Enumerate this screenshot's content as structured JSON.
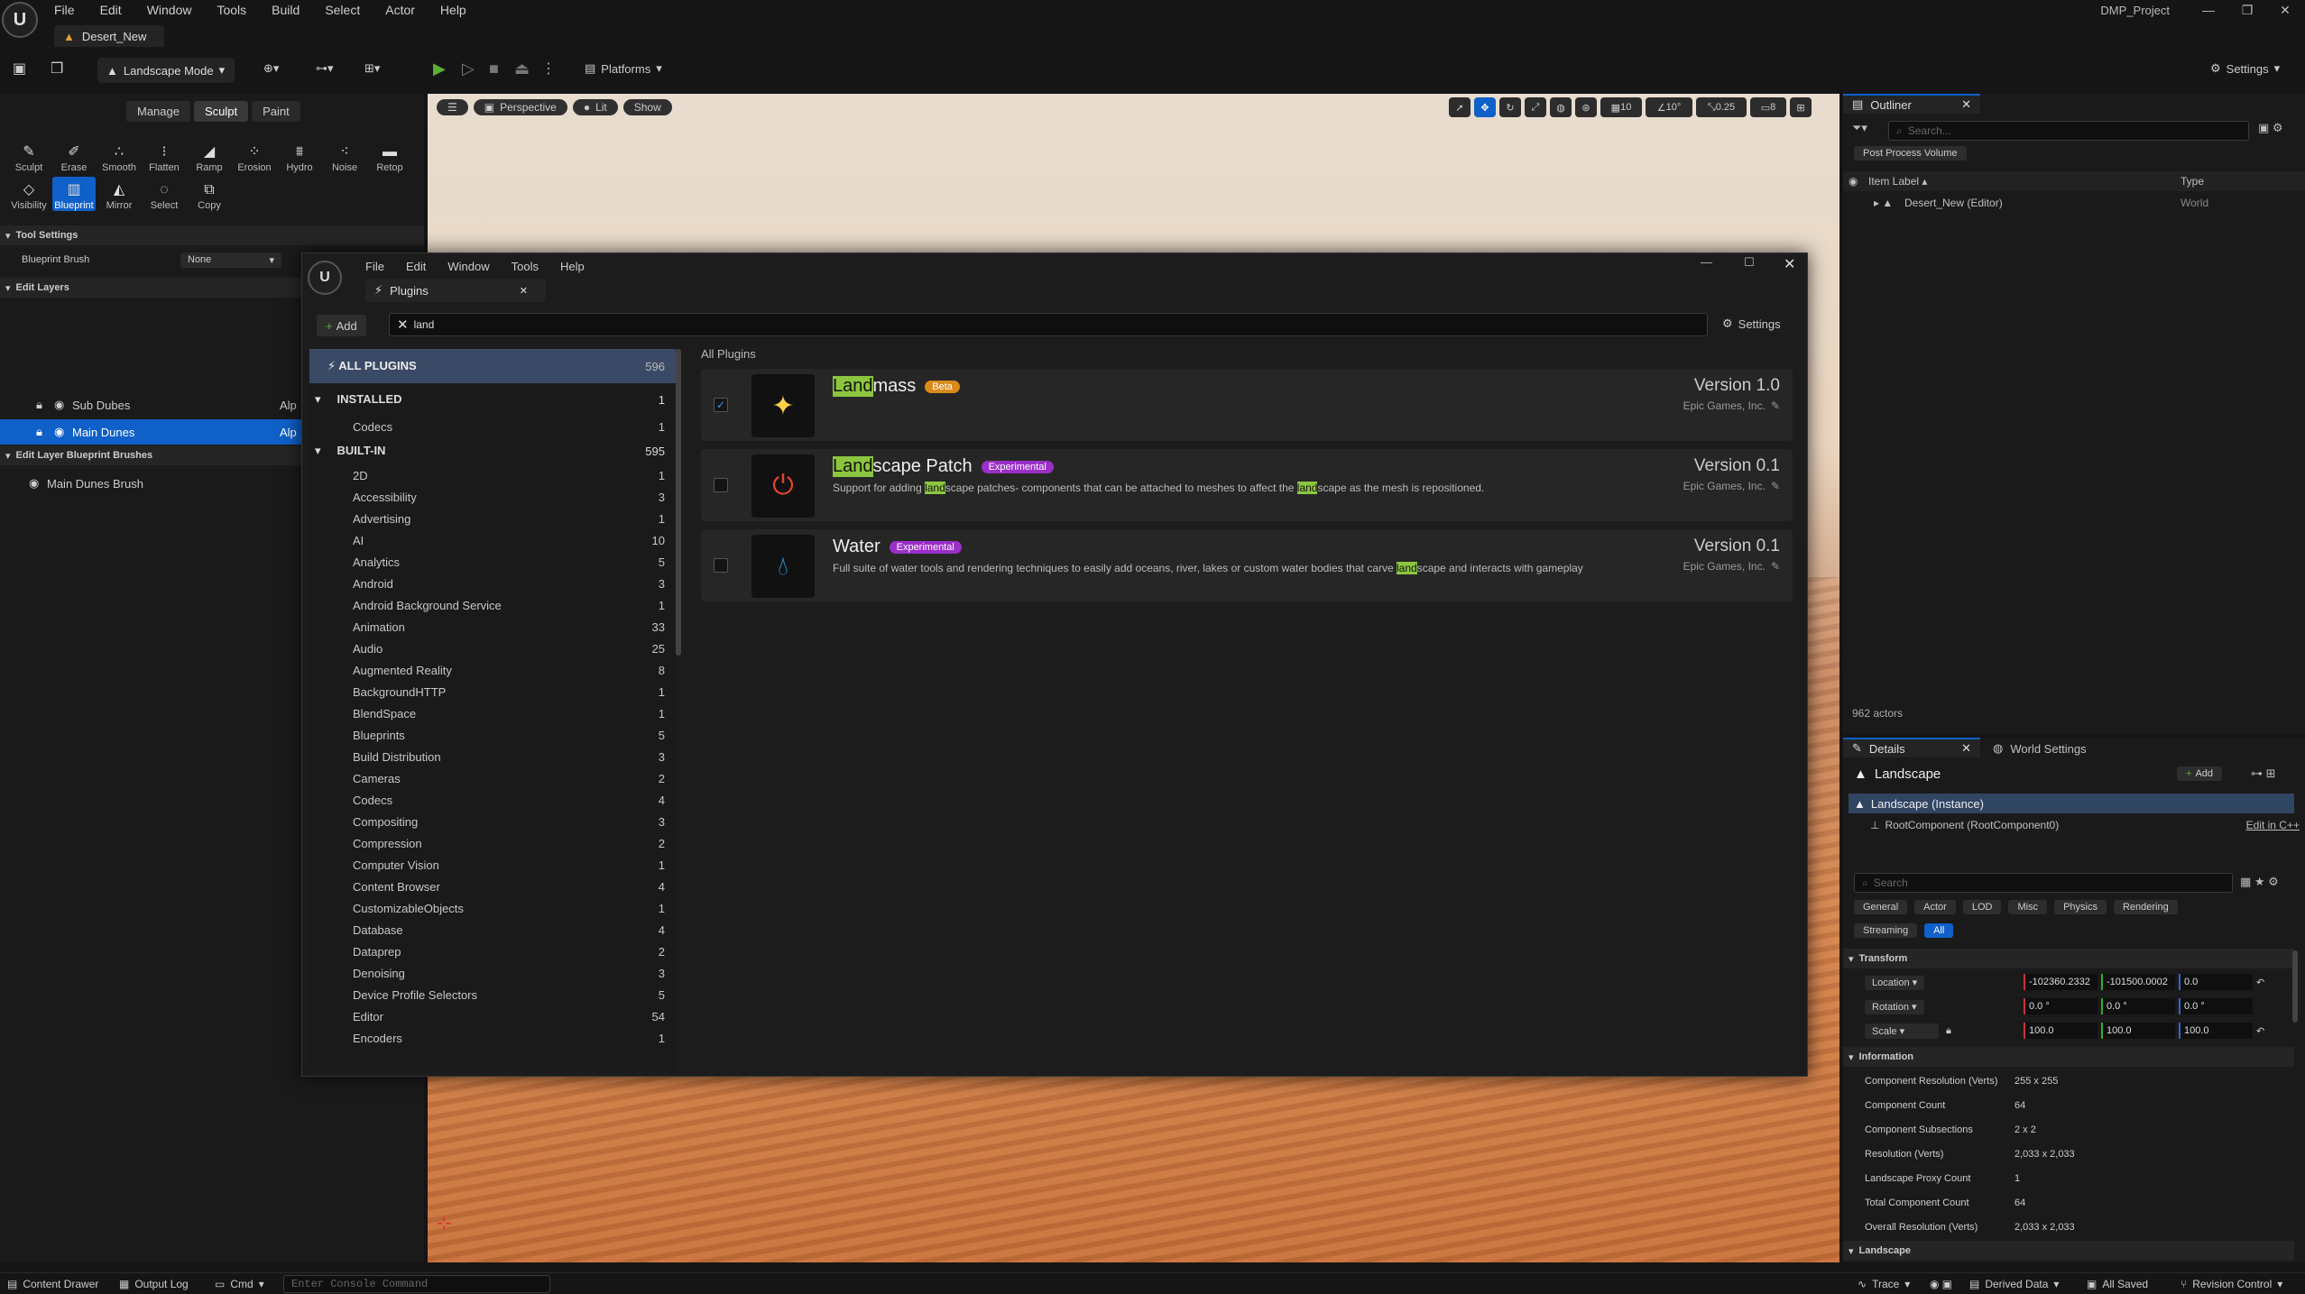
{
  "app": {
    "menu": [
      "File",
      "Edit",
      "Window",
      "Tools",
      "Build",
      "Select",
      "Actor",
      "Help"
    ],
    "level_tab": "Desert_New",
    "project": "DMP_Project"
  },
  "toolbar": {
    "mode": "Landscape Mode",
    "platforms": "Platforms",
    "settings": "Settings"
  },
  "landscape": {
    "modes": [
      "Manage",
      "Sculpt",
      "Paint"
    ],
    "tools_row1": [
      "Sculpt",
      "Erase",
      "Smooth",
      "Flatten",
      "Ramp",
      "Erosion",
      "Hydro",
      "Noise",
      "Retop"
    ],
    "tools_row2": [
      "Visibility",
      "Blueprint",
      "Mirror",
      "Select",
      "Copy"
    ],
    "tool_settings": "Tool Settings",
    "brush_label": "Blueprint Brush",
    "brush_value": "None",
    "edit_layers": "Edit Layers",
    "layers": [
      {
        "name": "Sub Dubes",
        "tag": "Alp"
      },
      {
        "name": "Main Dunes",
        "tag": "Alp"
      }
    ],
    "bp_brushes": "Edit Layer Blueprint Brushes",
    "brush_item": "Main Dunes Brush"
  },
  "viewport": {
    "perspective": "Perspective",
    "lit": "Lit",
    "show": "Show",
    "grid": "10",
    "angle": "10°",
    "scale": "0.25",
    "cam": "8"
  },
  "outliner": {
    "title": "Outliner",
    "search": "Search...",
    "filter": "Post Process Volume",
    "col_label": "Item Label ▴",
    "col_type": "Type",
    "row_label": "Desert_New (Editor)",
    "row_type": "World",
    "count": "962 actors"
  },
  "details": {
    "tab1": "Details",
    "tab2": "World Settings",
    "actor": "Landscape",
    "add": "Add",
    "instance": "Landscape (Instance)",
    "root": "RootComponent (RootComponent0)",
    "edit_cpp": "Edit in C++",
    "search": "Search",
    "filters": [
      "General",
      "Actor",
      "LOD",
      "Misc",
      "Physics",
      "Rendering"
    ],
    "filters2": [
      "Streaming",
      "All"
    ],
    "transform": "Transform",
    "location": {
      "label": "Location",
      "x": "-102360.2332",
      "y": "-101500.0002",
      "z": "0.0"
    },
    "rotation": {
      "label": "Rotation",
      "x": "0.0 °",
      "y": "0.0 °",
      "z": "0.0 °"
    },
    "scale": {
      "label": "Scale",
      "x": "100.0",
      "y": "100.0",
      "z": "100.0"
    },
    "information": "Information",
    "info": [
      {
        "k": "Component Resolution (Verts)",
        "v": "255 x 255"
      },
      {
        "k": "Component Count",
        "v": "64"
      },
      {
        "k": "Component Subsections",
        "v": "2 x 2"
      },
      {
        "k": "Resolution (Verts)",
        "v": "2,033 x 2,033"
      },
      {
        "k": "Landscape Proxy Count",
        "v": "1"
      },
      {
        "k": "Total Component Count",
        "v": "64"
      },
      {
        "k": "Overall Resolution (Verts)",
        "v": "2,033 x 2,033"
      }
    ],
    "landscape_sect": "Landscape"
  },
  "plugins": {
    "menu": [
      "File",
      "Edit",
      "Window",
      "Tools",
      "Help"
    ],
    "tab": "Plugins",
    "add": "Add",
    "search_value": "land",
    "settings": "Settings",
    "breadcrumb": "All Plugins",
    "all": {
      "label": "ALL PLUGINS",
      "count": "596"
    },
    "installed": {
      "label": "INSTALLED",
      "count": "1"
    },
    "installed_items": [
      {
        "name": "Codecs",
        "count": "1"
      }
    ],
    "builtin": {
      "label": "BUILT-IN",
      "count": "595"
    },
    "builtin_items": [
      {
        "name": "2D",
        "count": "1"
      },
      {
        "name": "Accessibility",
        "count": "3"
      },
      {
        "name": "Advertising",
        "count": "1"
      },
      {
        "name": "AI",
        "count": "10"
      },
      {
        "name": "Analytics",
        "count": "5"
      },
      {
        "name": "Android",
        "count": "3"
      },
      {
        "name": "Android Background Service",
        "count": "1"
      },
      {
        "name": "Animation",
        "count": "33"
      },
      {
        "name": "Audio",
        "count": "25"
      },
      {
        "name": "Augmented Reality",
        "count": "8"
      },
      {
        "name": "BackgroundHTTP",
        "count": "1"
      },
      {
        "name": "BlendSpace",
        "count": "1"
      },
      {
        "name": "Blueprints",
        "count": "5"
      },
      {
        "name": "Build Distribution",
        "count": "3"
      },
      {
        "name": "Cameras",
        "count": "2"
      },
      {
        "name": "Codecs",
        "count": "4"
      },
      {
        "name": "Compositing",
        "count": "3"
      },
      {
        "name": "Compression",
        "count": "2"
      },
      {
        "name": "Computer Vision",
        "count": "1"
      },
      {
        "name": "Content Browser",
        "count": "4"
      },
      {
        "name": "CustomizableObjects",
        "count": "1"
      },
      {
        "name": "Database",
        "count": "4"
      },
      {
        "name": "Dataprep",
        "count": "2"
      },
      {
        "name": "Denoising",
        "count": "3"
      },
      {
        "name": "Device Profile Selectors",
        "count": "5"
      },
      {
        "name": "Editor",
        "count": "54"
      },
      {
        "name": "Encoders",
        "count": "1"
      }
    ],
    "cards": [
      {
        "hl": "Land",
        "rest": "mass",
        "badge": "Beta",
        "desc": "",
        "version": "Version 1.0",
        "vendor": "Epic Games, Inc.",
        "checked": "✓"
      },
      {
        "hl": "Land",
        "rest": "scape Patch",
        "badge": "Experimental",
        "desc_pre": "Support for adding ",
        "desc_hl": "land",
        "desc_mid": "scape patches- components that can be attached to meshes to affect the ",
        "desc_hl2": "land",
        "desc_post": "scape as the mesh is repositioned.",
        "version": "Version 0.1",
        "vendor": "Epic Games, Inc."
      },
      {
        "name": "Water",
        "badge": "Experimental",
        "desc_pre": "Full suite of water tools and rendering techniques to easily add oceans, river, lakes or custom water bodies that carve ",
        "desc_hl": "land",
        "desc_post": "scape and interacts with gameplay",
        "version": "Version 0.1",
        "vendor": "Epic Games, Inc."
      }
    ]
  },
  "status": {
    "drawer": "Content Drawer",
    "log": "Output Log",
    "cmd": "Cmd",
    "console": "Enter Console Command",
    "trace": "Trace",
    "derived": "Derived Data",
    "saved": "All Saved",
    "revision": "Revision Control"
  }
}
